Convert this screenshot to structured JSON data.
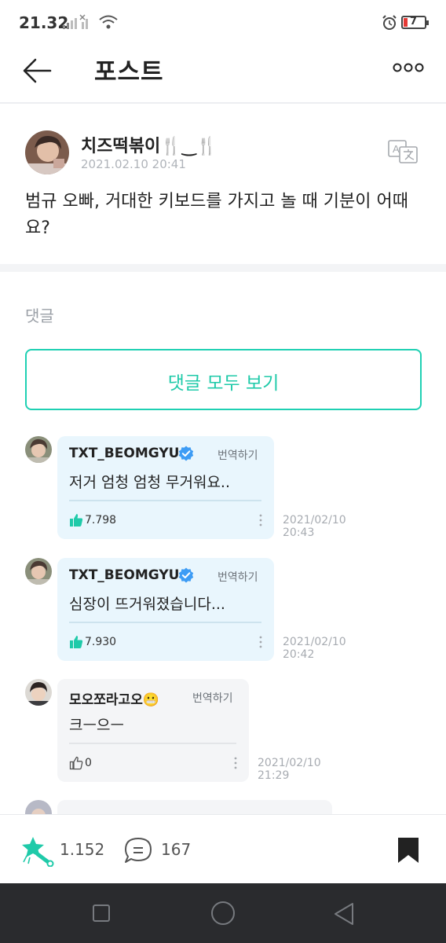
{
  "status_bar": {
    "time": "21.32",
    "battery": "7"
  },
  "header": {
    "title": "포스트"
  },
  "post": {
    "author": "치즈떡볶이🍴‿🍴",
    "date": "2021.02.10 20:41",
    "text": "범규 오빠, 거대한 키보드를 가지고 놀 때 기분이 어때요?"
  },
  "comments_section": {
    "label": "댓글",
    "view_all_label": "댓글 모두 보기"
  },
  "comments": [
    {
      "author": "TXT_BEOMGYU",
      "translate": "번역하기",
      "text": "저거 엄청 엄청 무거워요..",
      "likes": "7.798",
      "time_line1": "2021/02/10",
      "time_line2": "20:43"
    },
    {
      "author": "TXT_BEOMGYU",
      "translate": "번역하기",
      "text": "심장이 뜨거워졌습니다...",
      "likes": "7.930",
      "time_line1": "2021/02/10",
      "time_line2": "20:42"
    },
    {
      "author": "모오쪼라고오😬",
      "translate": "번역하기",
      "text": "크ㅡ으ㅡ",
      "likes": "0",
      "time_line1": "2021/02/10",
      "time_line2": "21:29"
    }
  ],
  "bottom_bar": {
    "cheer_count": "1.152",
    "comment_count": "167"
  },
  "colors": {
    "accent": "#1fd0b3",
    "artist_bubble": "#e9f6fd",
    "fan_bubble": "#f4f5f7",
    "nav_bar": "#2a2b2e"
  },
  "icons": [
    "back-arrow-icon",
    "more-icon",
    "translate-icon",
    "verified-icon",
    "thumbs-up-icon",
    "kebab-menu-icon",
    "cheer-icon",
    "comment-icon",
    "bookmark-icon"
  ]
}
